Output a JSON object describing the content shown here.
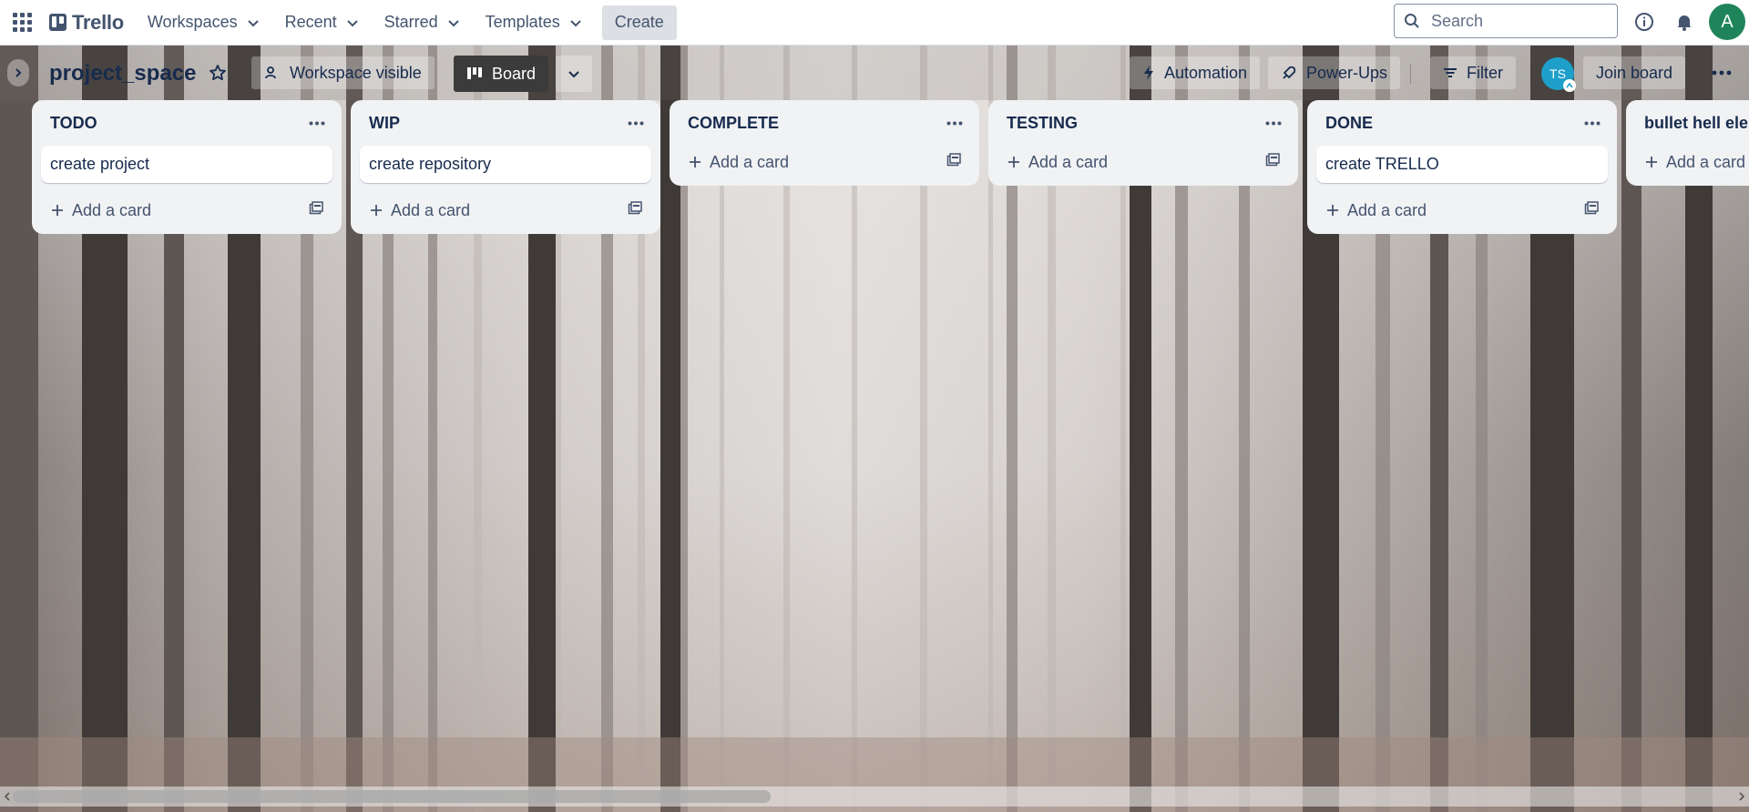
{
  "topbar": {
    "brand": "Trello",
    "nav": [
      {
        "label": "Workspaces"
      },
      {
        "label": "Recent"
      },
      {
        "label": "Starred"
      },
      {
        "label": "Templates"
      }
    ],
    "create_label": "Create",
    "search_placeholder": "Search",
    "account_initial": "A",
    "colors": {
      "account": "#1f845a"
    }
  },
  "board": {
    "title": "project_space",
    "visibility_label": "Workspace visible",
    "view_label": "Board",
    "automation_label": "Automation",
    "powerups_label": "Power-Ups",
    "filter_label": "Filter",
    "member_initials": "TS",
    "join_label": "Join board"
  },
  "lists": [
    {
      "title": "TODO",
      "cards": [
        "create project"
      ],
      "add_label": "Add a card"
    },
    {
      "title": "WIP",
      "cards": [
        "create repository"
      ],
      "add_label": "Add a card"
    },
    {
      "title": "COMPLETE",
      "cards": [],
      "add_label": "Add a card"
    },
    {
      "title": "TESTING",
      "cards": [],
      "add_label": "Add a card"
    },
    {
      "title": "DONE",
      "cards": [
        "create TRELLO"
      ],
      "add_label": "Add a card"
    },
    {
      "title": "bullet hell elem",
      "cards": [],
      "add_label": "Add a card"
    }
  ]
}
